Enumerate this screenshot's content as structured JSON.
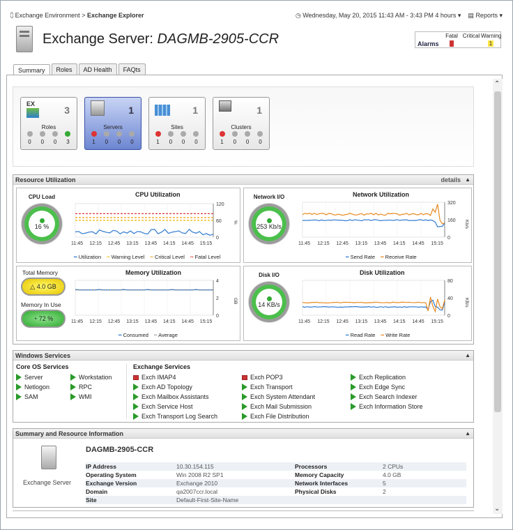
{
  "header": {
    "breadcrumb_root": "Exchange Environment",
    "breadcrumb_sep": ">",
    "breadcrumb_current": "Exchange Explorer",
    "datetime": "Wednesday, May 20, 2015 11:43 AM - 3:43 PM 4 hours",
    "reports": "Reports"
  },
  "title": {
    "prefix": "Exchange Server:",
    "name": "DAGMB-2905-CCR"
  },
  "alarms": {
    "label": "Alarms",
    "fatal_label": "Fatal",
    "critical_label": "Critical",
    "warning_label": "Warning",
    "fatal": "",
    "critical": "",
    "warning": "1"
  },
  "tabs": [
    "Summary",
    "Roles",
    "AD Health",
    "FAQts"
  ],
  "tiles": [
    {
      "name": "Roles",
      "count": "3",
      "icon_label": "EX",
      "s": [
        "0",
        "0",
        "0",
        "3"
      ]
    },
    {
      "name": "Servers",
      "count": "1",
      "s": [
        "1",
        "0",
        "0",
        "0"
      ]
    },
    {
      "name": "Sites",
      "count": "1",
      "s": [
        "1",
        "0",
        "0",
        "0"
      ]
    },
    {
      "name": "Clusters",
      "count": "1",
      "s": [
        "1",
        "0",
        "0",
        "0"
      ]
    }
  ],
  "resource": {
    "title": "Resource Utilization",
    "details": "details",
    "cpu": {
      "gauge_label": "CPU Load",
      "value": "16 %",
      "chart_title": "CPU Utilization",
      "y_ticks": [
        "120",
        "60",
        "0"
      ],
      "y_unit": "%",
      "x_ticks": [
        "11:45",
        "12:15",
        "12:45",
        "13:15",
        "13:45",
        "14:15",
        "14:45",
        "15:15"
      ],
      "legend": [
        "Utilization",
        "Warning Level",
        "Critical Level",
        "Fatal Level"
      ]
    },
    "network": {
      "gauge_label": "Network I/O",
      "value": "253 Kb/s",
      "chart_title": "Network Utilization",
      "y_ticks": [
        "320",
        "160",
        "0"
      ],
      "y_unit": "Kb/s",
      "x_ticks": [
        "11:45",
        "12:15",
        "12:45",
        "13:15",
        "13:45",
        "14:15",
        "14:45",
        "15:15"
      ],
      "legend": [
        "Send Rate",
        "Receive Rate"
      ]
    },
    "memory": {
      "total_label": "Total Memory",
      "total": "4.0 GB",
      "inuse_label": "Memory In Use",
      "inuse": "72 %",
      "chart_title": "Memory Utilization",
      "y_ticks": [
        "4",
        "2",
        "0"
      ],
      "y_unit": "GB",
      "x_ticks": [
        "11:45",
        "12:15",
        "12:45",
        "13:15",
        "13:45",
        "14:15",
        "14:45",
        "15:15"
      ],
      "legend": [
        "Consumed",
        "Average"
      ]
    },
    "disk": {
      "gauge_label": "Disk I/O",
      "value": "14 KB/s",
      "chart_title": "Disk Utilization",
      "y_ticks": [
        "80",
        "40",
        "0"
      ],
      "y_unit": "KB/s",
      "x_ticks": [
        "11:45",
        "12:15",
        "12:45",
        "13:15",
        "13:45",
        "14:15",
        "14:45",
        "15:15"
      ],
      "legend": [
        "Read Rate",
        "Write Rate"
      ]
    }
  },
  "services": {
    "title": "Windows Services",
    "core_title": "Core OS Services",
    "core_col1": [
      "Server",
      "Netlogon",
      "SAM"
    ],
    "core_col2": [
      "Workstation",
      "RPC",
      "WMI"
    ],
    "exch_title": "Exchange Services",
    "exch_col1": [
      {
        "name": "Exch IMAP4",
        "state": "stopped"
      },
      {
        "name": "Exch AD Topology",
        "state": "running"
      },
      {
        "name": "Exch Mailbox Assistants",
        "state": "running"
      },
      {
        "name": "Exch Service Host",
        "state": "running"
      },
      {
        "name": "Exch Transport Log Search",
        "state": "running"
      }
    ],
    "exch_col2": [
      {
        "name": "Exch POP3",
        "state": "stopped"
      },
      {
        "name": "Exch Transport",
        "state": "running"
      },
      {
        "name": "Exch System Attendant",
        "state": "running"
      },
      {
        "name": "Exch Mail Submission",
        "state": "running"
      },
      {
        "name": "Exch File Distribution",
        "state": "running"
      }
    ],
    "exch_col3": [
      {
        "name": "Exch Replication",
        "state": "running"
      },
      {
        "name": "Exch Edge Sync",
        "state": "running"
      },
      {
        "name": "Exch Search Indexer",
        "state": "running"
      },
      {
        "name": "Exch Information Store",
        "state": "running"
      }
    ]
  },
  "info": {
    "title": "Summary and Resource Information",
    "icon_label": "Exchange Server",
    "server_name": "DAGMB-2905-CCR",
    "rows": [
      {
        "k": "IP Address",
        "v": "10.30.154.115",
        "k2": "Processors",
        "v2": "2 CPUs"
      },
      {
        "k": "Operating System",
        "v": "Win 2008 R2 SP1",
        "k2": "Memory Capacity",
        "v2": "4.0 GB"
      },
      {
        "k": "Exchange Version",
        "v": "Exchange 2010",
        "k2": "Network Interfaces",
        "v2": "5"
      },
      {
        "k": "Domain",
        "v": "qa2007ccr.local",
        "k2": "Physical Disks",
        "v2": "2"
      },
      {
        "k": "Site",
        "v": "Default-First-Site-Name",
        "k2": "",
        "v2": ""
      }
    ]
  }
}
